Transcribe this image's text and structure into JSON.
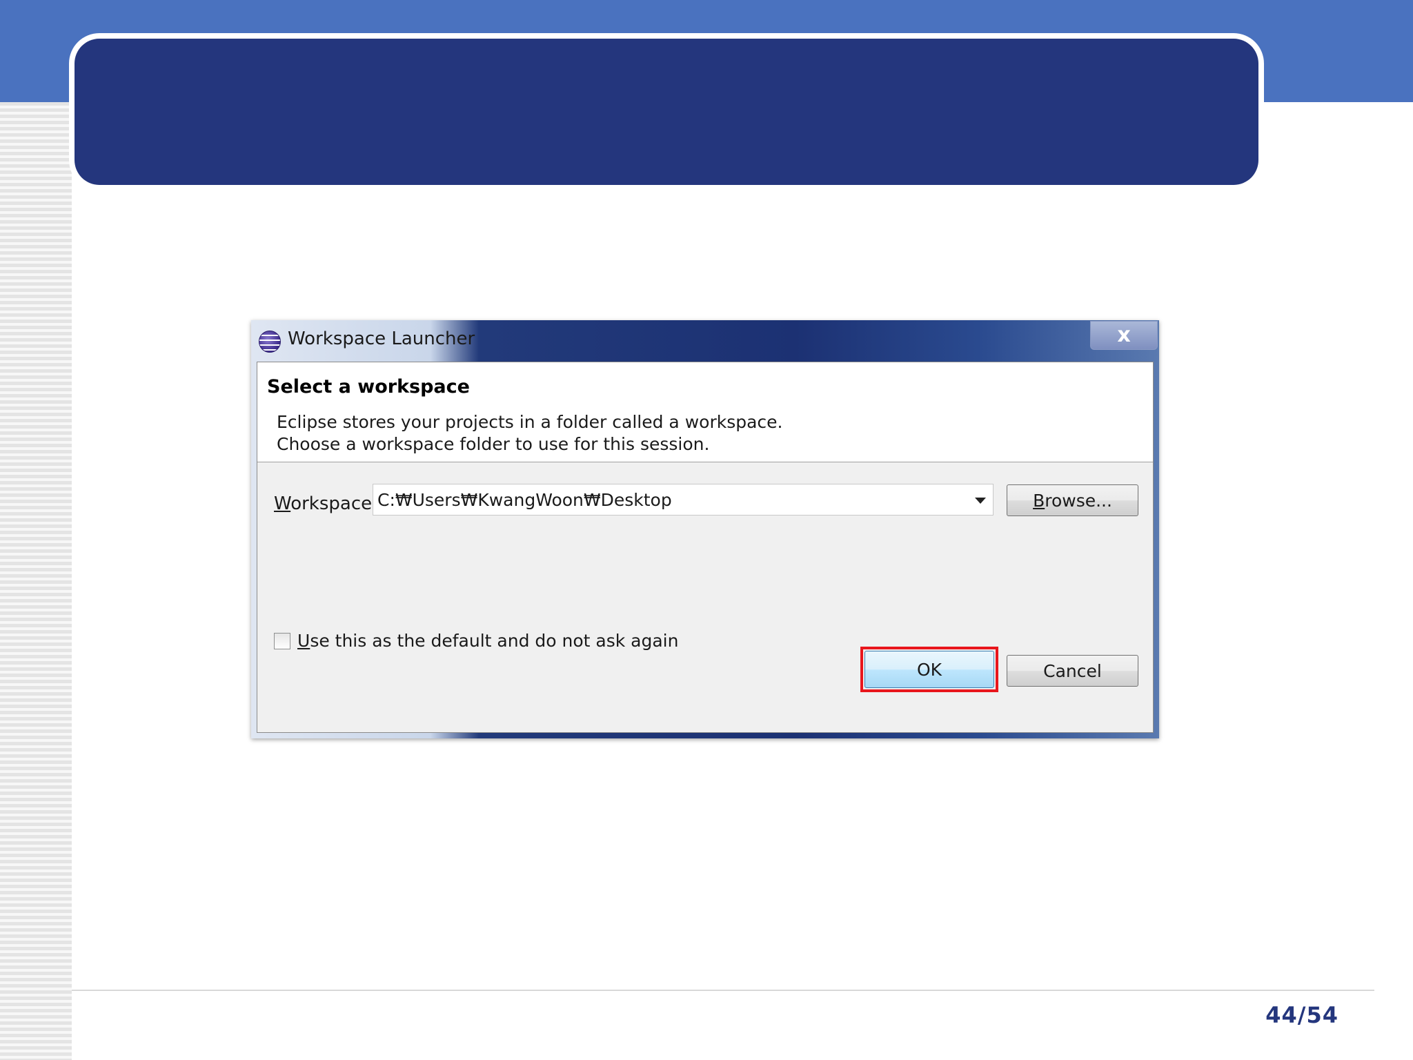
{
  "slide": {
    "page_number": "44/54"
  },
  "dialog": {
    "title": "Workspace Launcher",
    "close_label": "x",
    "header_title": "Select a workspace",
    "description_line1": "Eclipse stores your projects in a folder called a workspace.",
    "description_line2": "Choose a workspace folder to use for this session.",
    "workspace_label_mnemonic": "W",
    "workspace_label_rest": "orkspace:",
    "workspace_value": "C:₩Users₩KwangWoon₩Desktop",
    "browse_mnemonic": "B",
    "browse_rest": "rowse...",
    "checkbox_mnemonic": "U",
    "checkbox_rest": "se this as the default and do not ask again",
    "checkbox_checked": false,
    "ok_label": "OK",
    "cancel_label": "Cancel",
    "highlight_color": "#e8161c"
  }
}
